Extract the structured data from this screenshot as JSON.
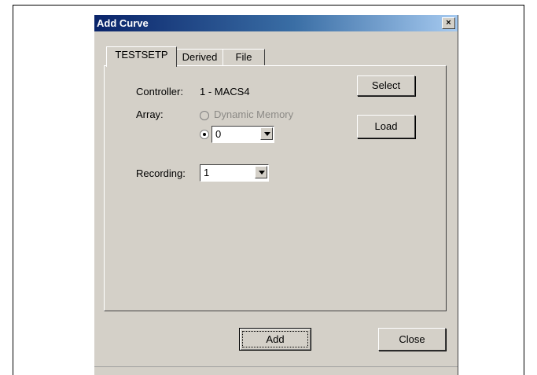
{
  "dialog": {
    "title": "Add Curve",
    "close_glyph": "×"
  },
  "tabs": [
    {
      "label": "TESTSETP",
      "active": true
    },
    {
      "label": "Derived",
      "active": false
    },
    {
      "label": "File",
      "active": false
    }
  ],
  "form": {
    "controller_label": "Controller:",
    "controller_value": "1 - MACS4",
    "array_label": "Array:",
    "dynamic_memory_label": "Dynamic Memory",
    "dynamic_memory_enabled": false,
    "array_value": "0",
    "recording_label": "Recording:",
    "recording_value": "1"
  },
  "buttons": {
    "select": "Select",
    "load": "Load",
    "add": "Add",
    "close": "Close"
  },
  "colors": {
    "titlebar_start": "#0a246a",
    "titlebar_end": "#a6caf0",
    "face": "#d4d0c8"
  }
}
